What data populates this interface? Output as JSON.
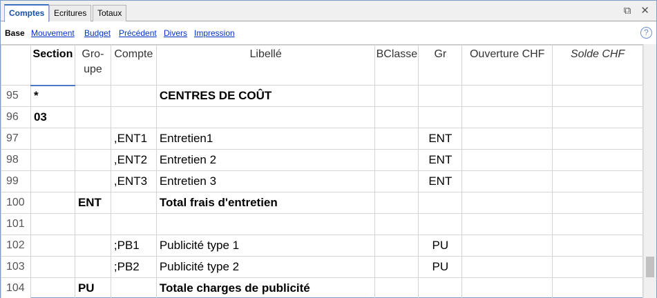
{
  "tabs": [
    "Comptes",
    "Ecritures",
    "Totaux"
  ],
  "active_tab": "Comptes",
  "subnav": [
    "Base",
    "Mouvement",
    "Budget",
    "Précédent",
    "Divers",
    "Impression"
  ],
  "icons": {
    "restore": "restore-window-icon",
    "close": "close-icon",
    "help": "help-icon"
  },
  "colors": {
    "accent": "#3b6fc2",
    "link": "#0033cc",
    "grid_line": "#d4d4d4"
  },
  "columns": [
    "Section",
    "Gro-upe",
    "Compte",
    "Libellé",
    "BClasse",
    "Gr",
    "Ouverture CHF",
    "Solde CHF"
  ],
  "rows": [
    {
      "num": "95",
      "section": "*",
      "groupe": "",
      "compte": "",
      "libelle": "CENTRES DE COÛT",
      "bclasse": "",
      "gr": "",
      "ouverture": "",
      "solde": ""
    },
    {
      "num": "96",
      "section": "03",
      "groupe": "",
      "compte": "",
      "libelle": "",
      "bclasse": "",
      "gr": "",
      "ouverture": "",
      "solde": ""
    },
    {
      "num": "97",
      "section": "",
      "groupe": "",
      "compte": ",ENT1",
      "libelle": "Entretien1",
      "bclasse": "",
      "gr": "ENT",
      "ouverture": "",
      "solde": ""
    },
    {
      "num": "98",
      "section": "",
      "groupe": "",
      "compte": ",ENT2",
      "libelle": "Entretien 2",
      "bclasse": "",
      "gr": "ENT",
      "ouverture": "",
      "solde": ""
    },
    {
      "num": "99",
      "section": "",
      "groupe": "",
      "compte": ",ENT3",
      "libelle": "Entretien 3",
      "bclasse": "",
      "gr": "ENT",
      "ouverture": "",
      "solde": ""
    },
    {
      "num": "100",
      "section": "",
      "groupe": "ENT",
      "compte": "",
      "libelle": "Total frais d'entretien",
      "bclasse": "",
      "gr": "",
      "ouverture": "",
      "solde": ""
    },
    {
      "num": "101",
      "section": "",
      "groupe": "",
      "compte": "",
      "libelle": "",
      "bclasse": "",
      "gr": "",
      "ouverture": "",
      "solde": ""
    },
    {
      "num": "102",
      "section": "",
      "groupe": "",
      "compte": ";PB1",
      "libelle": "Publicité type 1",
      "bclasse": "",
      "gr": "PU",
      "ouverture": "",
      "solde": ""
    },
    {
      "num": "103",
      "section": "",
      "groupe": "",
      "compte": ";PB2",
      "libelle": "Publicité type 2",
      "bclasse": "",
      "gr": "PU",
      "ouverture": "",
      "solde": ""
    },
    {
      "num": "104",
      "section": "",
      "groupe": "PU",
      "compte": "",
      "libelle": "Totale charges de publicité",
      "bclasse": "",
      "gr": "",
      "ouverture": "",
      "solde": ""
    }
  ]
}
